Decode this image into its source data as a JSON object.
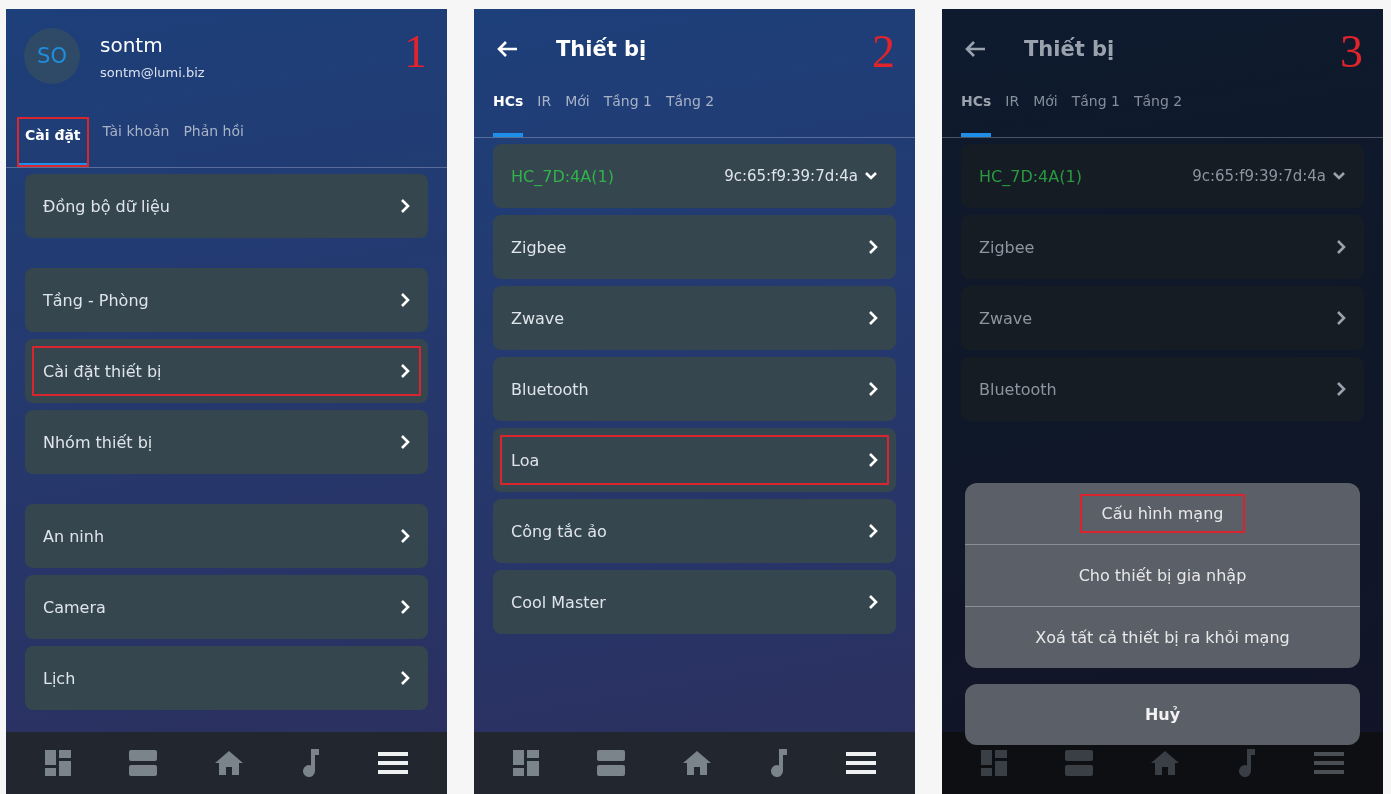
{
  "panels": [
    {
      "number": "1",
      "header": {
        "kind": "profile",
        "avatar": "SO",
        "name": "sontm",
        "email": "sontm@lumi.biz"
      },
      "dimmed": false,
      "tabs": [
        {
          "label": "Cài đặt",
          "selected": true,
          "highlighted": true
        },
        {
          "label": "Tài khoản",
          "selected": false,
          "highlighted": false
        },
        {
          "label": "Phản hồi",
          "selected": false,
          "highlighted": false
        }
      ],
      "groups": [
        [
          {
            "kind": "link",
            "label": "Đồng bộ dữ liệu",
            "highlighted": false
          }
        ],
        [
          {
            "kind": "link",
            "label": "Tầng - Phòng",
            "highlighted": false
          },
          {
            "kind": "link",
            "label": "Cài đặt thiết bị",
            "highlighted": true
          },
          {
            "kind": "link",
            "label": "Nhóm thiết bị",
            "highlighted": false
          }
        ],
        [
          {
            "kind": "link",
            "label": "An ninh",
            "highlighted": false
          },
          {
            "kind": "link",
            "label": "Camera",
            "highlighted": false
          },
          {
            "kind": "link",
            "label": "Lịch",
            "highlighted": false
          }
        ]
      ]
    },
    {
      "number": "2",
      "header": {
        "kind": "back",
        "title": "Thiết bị"
      },
      "dimmed": false,
      "tabs": [
        {
          "label": "HCs",
          "selected": true,
          "highlighted": false
        },
        {
          "label": "IR",
          "selected": false,
          "highlighted": false
        },
        {
          "label": "Mới",
          "selected": false,
          "highlighted": false
        },
        {
          "label": "Tầng 1",
          "selected": false,
          "highlighted": false
        },
        {
          "label": "Tầng 2",
          "selected": false,
          "highlighted": false
        }
      ],
      "groups": [
        [
          {
            "kind": "hub",
            "label": "HC_7D:4A(1)",
            "detail": "9c:65:f9:39:7d:4a",
            "color": "#2fb34a",
            "highlighted": false
          },
          {
            "kind": "link",
            "label": "Zigbee",
            "highlighted": false
          },
          {
            "kind": "link",
            "label": "Zwave",
            "highlighted": false
          },
          {
            "kind": "link",
            "label": "Bluetooth",
            "highlighted": false
          },
          {
            "kind": "link",
            "label": "Loa",
            "highlighted": true
          },
          {
            "kind": "link",
            "label": "Công tắc ảo",
            "highlighted": false
          },
          {
            "kind": "link",
            "label": "Cool Master",
            "highlighted": false
          }
        ]
      ]
    },
    {
      "number": "3",
      "header": {
        "kind": "back",
        "title": "Thiết bị"
      },
      "dimmed": true,
      "tabs": [
        {
          "label": "HCs",
          "selected": true,
          "highlighted": false
        },
        {
          "label": "IR",
          "selected": false,
          "highlighted": false
        },
        {
          "label": "Mới",
          "selected": false,
          "highlighted": false
        },
        {
          "label": "Tầng 1",
          "selected": false,
          "highlighted": false
        },
        {
          "label": "Tầng 2",
          "selected": false,
          "highlighted": false
        }
      ],
      "groups": [
        [
          {
            "kind": "hub",
            "label": "HC_7D:4A(1)",
            "detail": "9c:65:f9:39:7d:4a",
            "color": "#2a9a40",
            "highlighted": false
          },
          {
            "kind": "link",
            "label": "Zigbee",
            "highlighted": false
          },
          {
            "kind": "link",
            "label": "Zwave",
            "highlighted": false
          },
          {
            "kind": "link",
            "label": "Bluetooth",
            "highlighted": false
          }
        ]
      ],
      "sheet": {
        "options": [
          {
            "label": "Cấu hình mạng",
            "highlighted": true
          },
          {
            "label": "Cho thiết bị gia nhập",
            "highlighted": false
          },
          {
            "label": "Xoá tất cả thiết bị ra khỏi mạng",
            "highlighted": false
          }
        ],
        "cancel": "Huỷ"
      }
    }
  ]
}
